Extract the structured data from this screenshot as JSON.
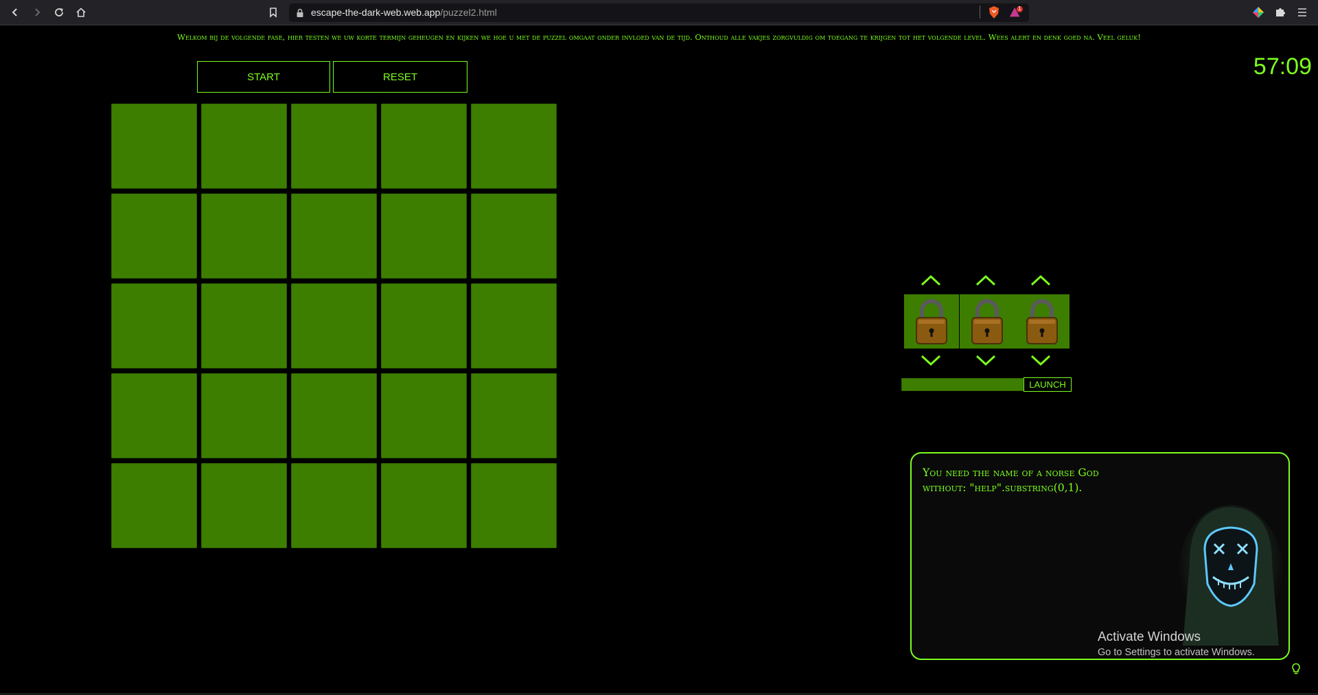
{
  "browser": {
    "url_domain": "escape-the-dark-web.web.app",
    "url_path": "/puzzel2.html",
    "shield_badge": "1"
  },
  "page": {
    "intro": "Welkom bij de volgende fase, hier testen we uw korte termijn geheugen en kijken we hoe u met de puzzel omgaat onder invloed van de tijd. Onthoud alle vakjes zorgvuldig om toegang te krijgen tot het volgende level. Wees alert en denk goed na. Veel geluk!",
    "timer": "57:09",
    "start_label": "START",
    "reset_label": "RESET",
    "grid": {
      "rows": 5,
      "cols": 5,
      "tile_color": "#3d7e00"
    },
    "lock": {
      "digits": 3,
      "launch_label": "LAUNCH"
    },
    "hint_line1": "You need the name of a norse God",
    "hint_line2": "without: \"help\".substring(0,1).",
    "watermark_title": "Activate Windows",
    "watermark_sub": "Go to Settings to activate Windows.",
    "accent": "#7dff1e"
  }
}
